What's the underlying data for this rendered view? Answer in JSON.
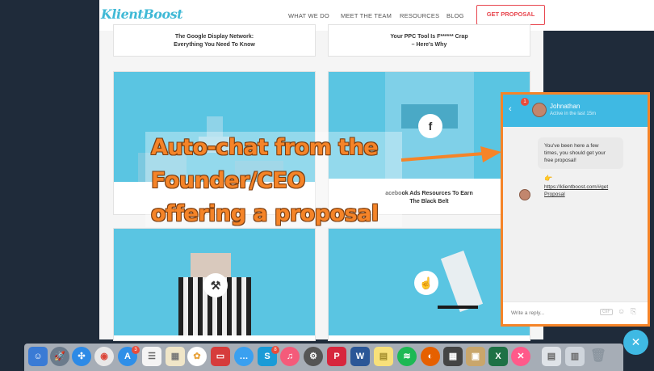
{
  "site": {
    "logo": "KlientBoost",
    "nav": [
      "WHAT WE DO",
      "MEET THE TEAM",
      "RESOURCES",
      "BLOG"
    ],
    "cta": "GET PROPOSAL"
  },
  "cards": {
    "top_left_title": [
      "The Google Display Network:",
      "Everything You Need To Know"
    ],
    "top_right_title": [
      "Your PPC Tool Is F****** Crap",
      "– Here's Why"
    ],
    "mid_right_title": [
      "acebook Ads Resources To Earn",
      "The Black Belt"
    ]
  },
  "overlay": {
    "lines": [
      "Auto-chat from the",
      "Founder/CEO",
      "offering a proposal"
    ]
  },
  "chat": {
    "badge": "1",
    "name": "Johnathan",
    "status": "Active in the last 15m",
    "message_lines": [
      "You've been here a few",
      "times, you should get your",
      "free proposal!"
    ],
    "link_lines": [
      "https://klientboost.com/#get",
      "Proposal"
    ],
    "placeholder": "Write a reply..."
  },
  "dock": {
    "badges": {
      "app_store": "3",
      "skype": "8"
    }
  },
  "colors": {
    "accent_orange": "#f58428",
    "brand_blue": "#3fb9e3",
    "cta_red": "#e8464e"
  }
}
